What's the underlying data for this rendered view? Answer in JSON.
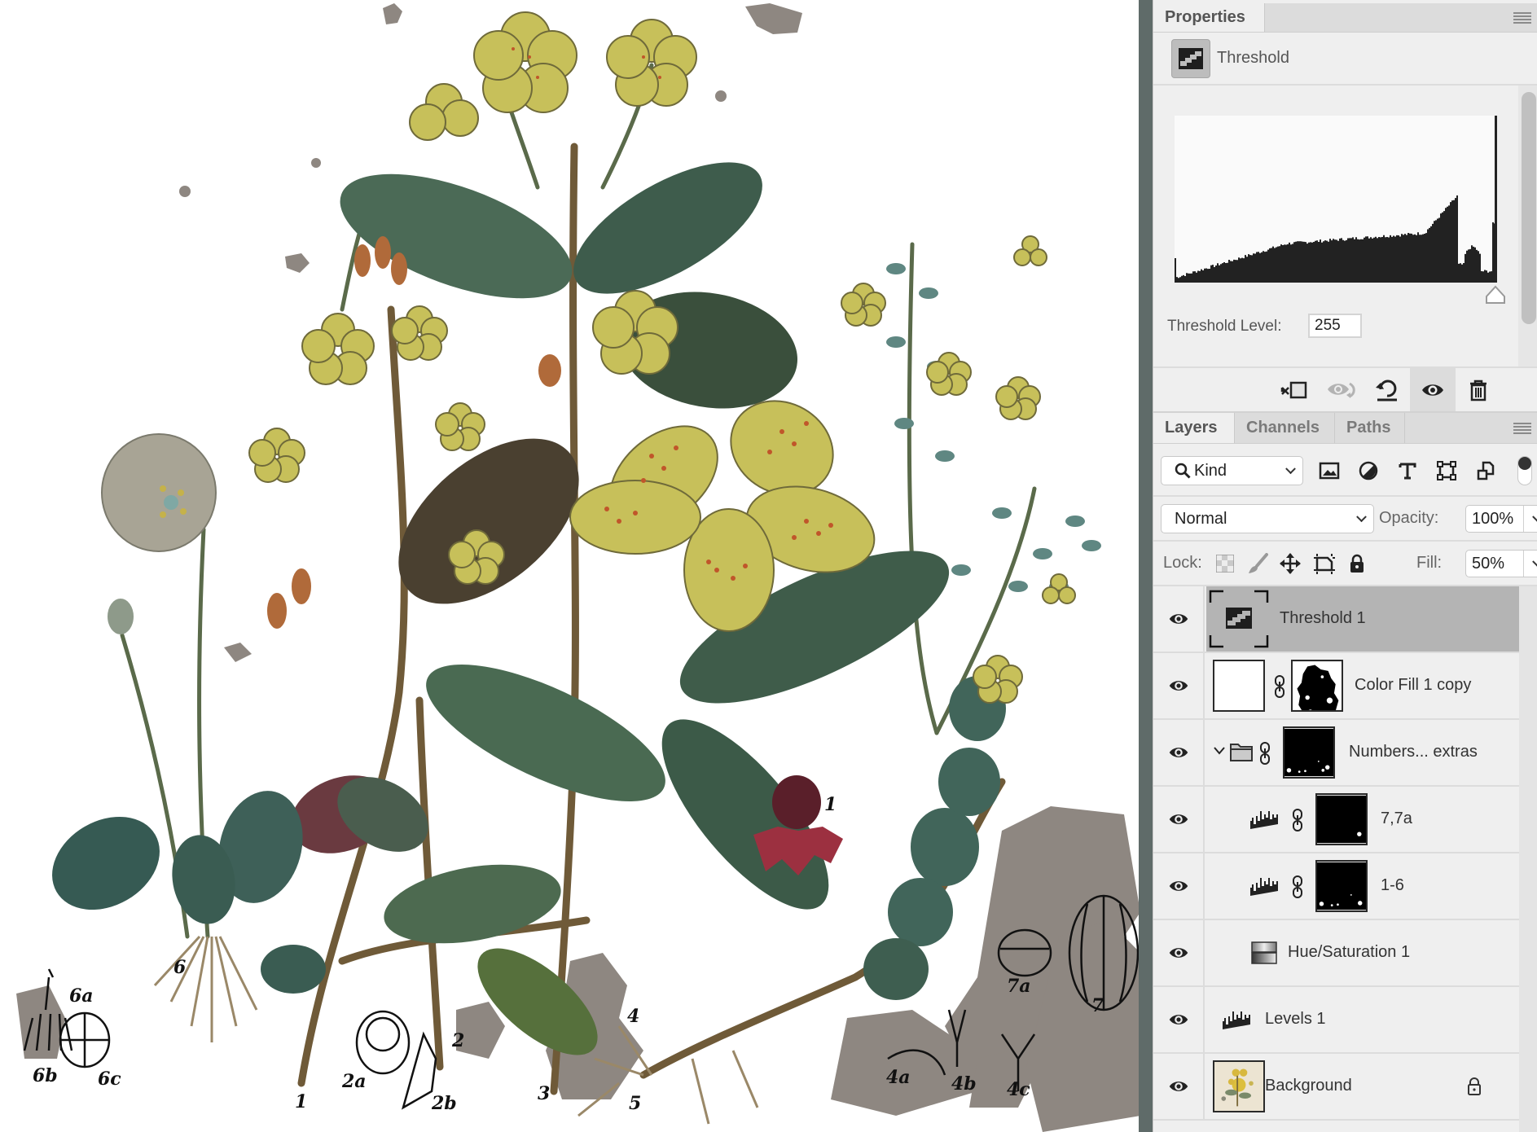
{
  "canvas": {
    "description": "Botanical illustration plate of St John's wort with numbered figures",
    "plate_labels": [
      "1",
      "1",
      "2",
      "2a",
      "2b",
      "3",
      "4",
      "4a",
      "4b",
      "4c",
      "5",
      "6",
      "6a",
      "6b",
      "6c",
      "7",
      "7a"
    ],
    "colors": {
      "flower_yellow": "#c9c25a",
      "leaf_green": "#3f5a49",
      "leaf_teal": "#6e8f8a",
      "stem_brown": "#7a5533",
      "speckle_gray": "#8e8781",
      "berry": "#5a1f2a",
      "edge_bar": "#5f6b69"
    }
  },
  "properties": {
    "tab_label": "Properties",
    "adjustment_type": "Threshold",
    "adjustment_icon": "threshold-icon",
    "threshold_level_label": "Threshold Level:",
    "threshold_level_value": "255",
    "histogram": {
      "description": "Luminosity histogram, low on the left rising to peaks near the highlights; slider at max",
      "slider_value": 255,
      "slider_max": 255
    },
    "footer_buttons": [
      {
        "name": "clip-to-layer",
        "icon": "clip-to-layer-icon"
      },
      {
        "name": "view-previous-state",
        "icon": "view-previous-icon"
      },
      {
        "name": "reset-adjustment",
        "icon": "reset-icon"
      },
      {
        "name": "toggle-visibility",
        "icon": "eye-icon",
        "active": true
      },
      {
        "name": "delete-adjustment",
        "icon": "trash-icon"
      }
    ]
  },
  "layers_panel": {
    "tabs": [
      {
        "label": "Layers",
        "active": true
      },
      {
        "label": "Channels",
        "active": false
      },
      {
        "label": "Paths",
        "active": false
      }
    ],
    "filter": {
      "kind_label": "Kind",
      "filter_icons": [
        "pixel-layer-filter-icon",
        "adjustment-layer-filter-icon",
        "type-layer-filter-icon",
        "shape-layer-filter-icon",
        "smart-object-filter-icon"
      ],
      "filter_toggle": "on"
    },
    "blend_mode": "Normal",
    "opacity_label": "Opacity:",
    "opacity_value": "100%",
    "lock_label": "Lock:",
    "lock_icons": [
      "lock-transparent-pixels-icon",
      "lock-image-pixels-icon",
      "lock-position-icon",
      "lock-artboard-icon",
      "lock-all-icon"
    ],
    "fill_label": "Fill:",
    "fill_value": "50%",
    "layers": [
      {
        "name": "Threshold 1",
        "type": "adjustment-threshold",
        "visible": true,
        "selected": true
      },
      {
        "name": "Color Fill 1 copy",
        "type": "color-fill",
        "visible": true,
        "has_mask": true
      },
      {
        "name": "Numbers... extras",
        "type": "group",
        "visible": true,
        "expanded": true,
        "has_mask": true
      },
      {
        "name": "7,7a",
        "type": "adjustment-levels",
        "visible": true,
        "has_mask": true,
        "indented": true
      },
      {
        "name": "1-6",
        "type": "adjustment-levels",
        "visible": true,
        "has_mask": true,
        "indented": true
      },
      {
        "name": "Hue/Saturation 1",
        "type": "adjustment-hue-saturation",
        "visible": true,
        "indented": true
      },
      {
        "name": "Levels 1",
        "type": "adjustment-levels",
        "visible": true
      },
      {
        "name": "Background",
        "type": "pixel",
        "visible": true,
        "locked": true
      }
    ]
  }
}
